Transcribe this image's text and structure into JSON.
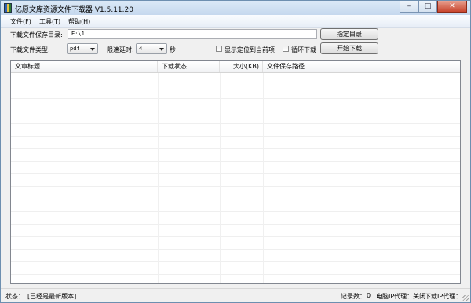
{
  "window": {
    "title": "亿愿文库资源文件下载器 V1.5.11.20",
    "minimize": "–",
    "maximize": "□",
    "close": "✕"
  },
  "menu": {
    "file": "文件(F)",
    "tools": "工具(T)",
    "help": "帮助(H)"
  },
  "form": {
    "save_dir_label": "下载文件保存目录:",
    "save_dir_value": "E:\\1",
    "choose_dir_button": "指定目录",
    "file_type_label": "下载文件类型:",
    "file_type_value": "pdf",
    "delay_label": "限速延时:",
    "delay_value": "4",
    "delay_unit": "秒",
    "show_current_label": "显示定位到当前项",
    "loop_label": "循环下载",
    "start_button": "开始下载"
  },
  "table": {
    "columns": [
      "文章标题",
      "下载状态",
      "大小(KB)",
      "文件保存路径"
    ],
    "rows": []
  },
  "status": {
    "state_label": "状态：",
    "state_value": "[已经是最新版本]",
    "records_label": "记录数：",
    "records_value": "0",
    "pc_proxy": "电脑IP代理：关闭",
    "dl_proxy": "下载IP代理："
  }
}
